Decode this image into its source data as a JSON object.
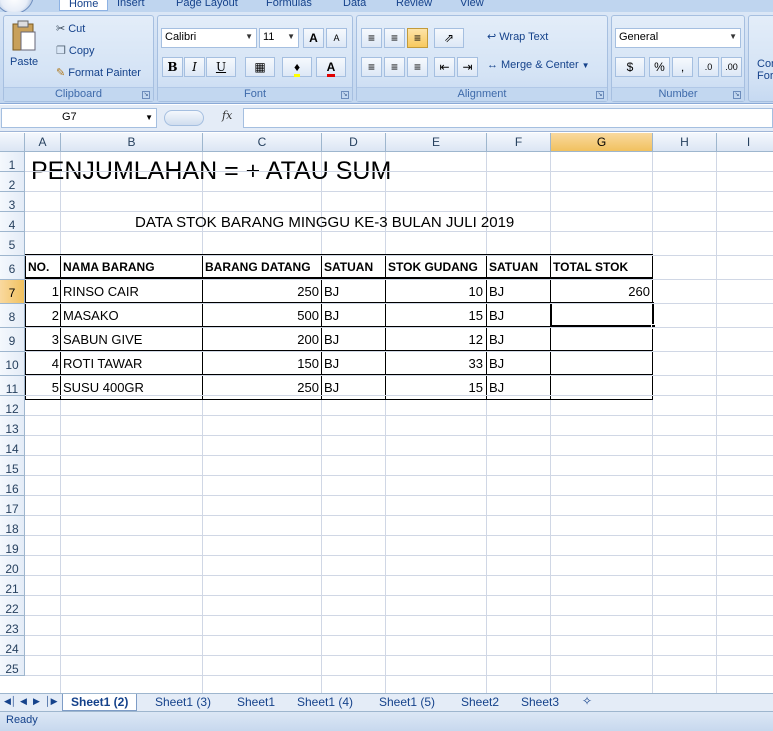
{
  "ribbon_tabs": [
    "Home",
    "Insert",
    "Page Layout",
    "Formulas",
    "Data",
    "Review",
    "View"
  ],
  "clipboard": {
    "paste": "Paste",
    "cut": "Cut",
    "copy": "Copy",
    "format_painter": "Format Painter",
    "label": "Clipboard"
  },
  "font": {
    "name": "Calibri",
    "size": "11",
    "label": "Font",
    "bold": "B",
    "italic": "I",
    "underline": "U",
    "grow": "A",
    "shrink": "A"
  },
  "alignment": {
    "wrap_text": "Wrap Text",
    "merge_center": "Merge & Center",
    "label": "Alignment"
  },
  "number": {
    "format": "General",
    "percent": "%",
    "comma": ",",
    "inc_decimal": ".0",
    "dec_decimal": ".00",
    "label": "Number"
  },
  "styles": {
    "conditional_partial_1": "Con",
    "conditional_partial_2": "For"
  },
  "formula_bar": {
    "name_box": "G7",
    "fx": "fx",
    "formula": ""
  },
  "columns": [
    "A",
    "B",
    "C",
    "D",
    "E",
    "F",
    "G",
    "H",
    "I"
  ],
  "selected_column": "G",
  "selected_row": "7",
  "rows": [
    "1",
    "2",
    "3",
    "4",
    "5",
    "6",
    "7",
    "8",
    "9",
    "10",
    "11",
    "12",
    "13",
    "14",
    "15",
    "16",
    "17",
    "18",
    "19",
    "20",
    "21",
    "22",
    "23",
    "24",
    "25"
  ],
  "sheet": {
    "title": "PENJUMLAHAN = + ATAU SUM",
    "subtitle": "DATA STOK BARANG MINGGU KE-3 BULAN JULI 2019",
    "headers": [
      "NO.",
      "NAMA BARANG",
      "BARANG DATANG",
      "SATUAN",
      "STOK GUDANG",
      "SATUAN",
      "TOTAL STOK"
    ],
    "data_rows": [
      {
        "no": "1",
        "nama": "RINSO CAIR",
        "datang": "250",
        "satuan1": "BJ",
        "stok": "10",
        "satuan2": "BJ",
        "total": "260"
      },
      {
        "no": "2",
        "nama": "MASAKO",
        "datang": "500",
        "satuan1": "BJ",
        "stok": "15",
        "satuan2": "BJ",
        "total": ""
      },
      {
        "no": "3",
        "nama": "SABUN GIVE",
        "datang": "200",
        "satuan1": "BJ",
        "stok": "12",
        "satuan2": "BJ",
        "total": ""
      },
      {
        "no": "4",
        "nama": "ROTI TAWAR",
        "datang": "150",
        "satuan1": "BJ",
        "stok": "33",
        "satuan2": "BJ",
        "total": ""
      },
      {
        "no": "5",
        "nama": "SUSU 400GR",
        "datang": "250",
        "satuan1": "BJ",
        "stok": "15",
        "satuan2": "BJ",
        "total": ""
      }
    ]
  },
  "sheet_tabs": [
    "Sheet1 (2)",
    "Sheet1 (3)",
    "Sheet1",
    "Sheet1 (4)",
    "Sheet1 (5)",
    "Sheet2",
    "Sheet3"
  ],
  "active_sheet": "Sheet1 (2)",
  "status": "Ready"
}
